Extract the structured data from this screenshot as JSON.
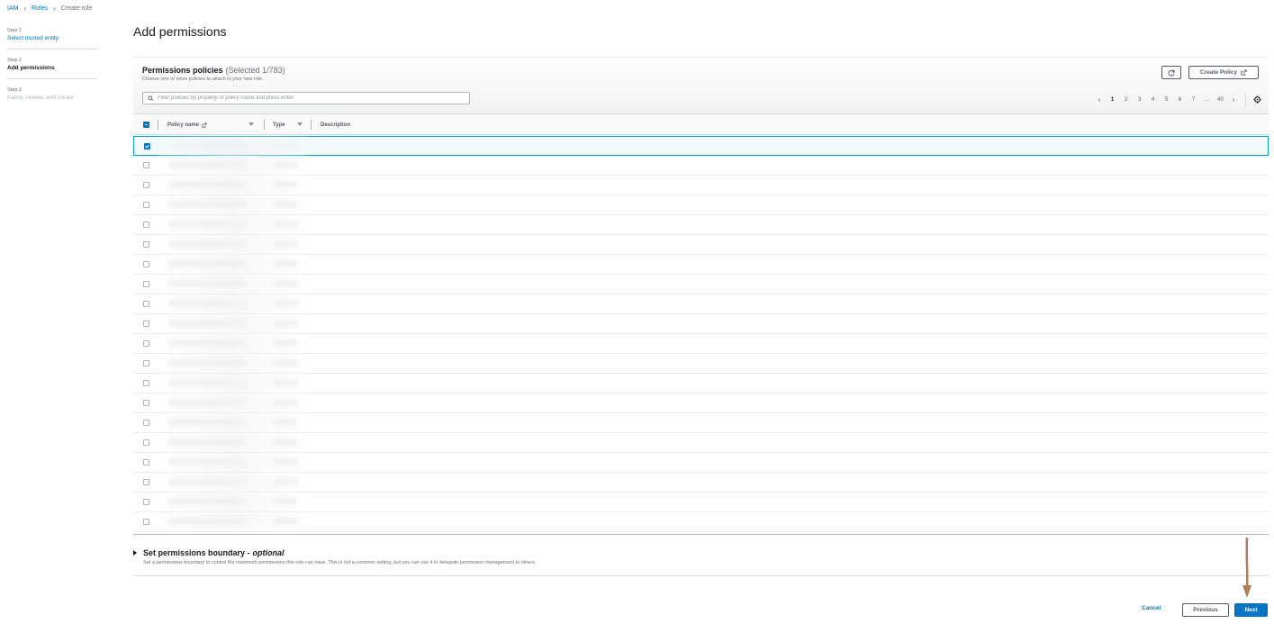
{
  "breadcrumb": {
    "items": [
      "IAM",
      "Roles"
    ],
    "current": "Create role"
  },
  "steps": [
    {
      "number": "Step 1",
      "label": "Select trusted entity"
    },
    {
      "number": "Step 2",
      "label": "Add permissions"
    },
    {
      "number": "Step 3",
      "label": "Name, review, and create"
    }
  ],
  "page_title": "Add permissions",
  "permissions": {
    "title": "Permissions policies",
    "selected_count": "(Selected 1/783)",
    "description": "Choose one or more policies to attach to your new role.",
    "create_policy_label": "Create Policy",
    "search_placeholder": "Filter policies by property or policy name and press enter",
    "pagination": {
      "pages": [
        "1",
        "2",
        "3",
        "4",
        "5",
        "6",
        "7"
      ],
      "ellipsis": "...",
      "last_page": "40",
      "current": "1"
    },
    "columns": [
      "Policy name",
      "Type",
      "Description"
    ],
    "row_count": 20,
    "selected_row_index": 0
  },
  "boundary": {
    "title": "Set permissions boundary -",
    "title_optional": "optional",
    "description": "Set a permissions boundary to control the maximum permissions this role can have. This is not a common setting, but you can use it to delegate permission management to others."
  },
  "footer": {
    "cancel_label": "Cancel",
    "previous_label": "Previous",
    "next_label": "Next"
  },
  "colors": {
    "link": "#0073bb",
    "primary_button": "#0a74c4",
    "selected_row_border": "#00a1c9",
    "annotation_arrow": "#b07a5c"
  }
}
